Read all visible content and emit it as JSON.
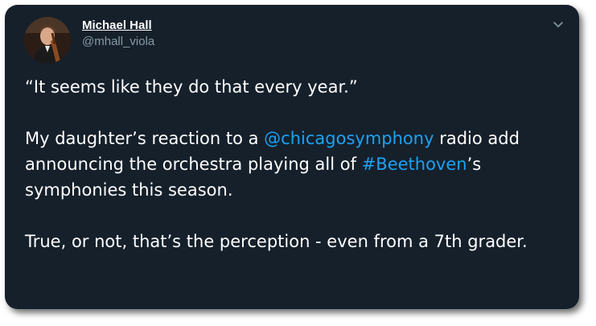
{
  "author": {
    "display_name": "Michael Hall",
    "handle": "@mhall_viola"
  },
  "icons": {
    "avatar": "profile-photo",
    "menu": "chevron-down-icon"
  },
  "colors": {
    "background": "#15202b",
    "link": "#1da1f2",
    "secondary_text": "#8899a6"
  },
  "tweet": {
    "line1": "“It seems like they do that every year.”",
    "p2_before": "My daughter’s reaction to a ",
    "mention": "@chicagosymphony",
    "p2_middle": " radio add announcing the orchestra playing all of ",
    "hashtag": "#Beethoven",
    "p2_after": "’s symphonies this season.",
    "p3": "True, or not, that’s the perception - even from a 7th grader."
  }
}
